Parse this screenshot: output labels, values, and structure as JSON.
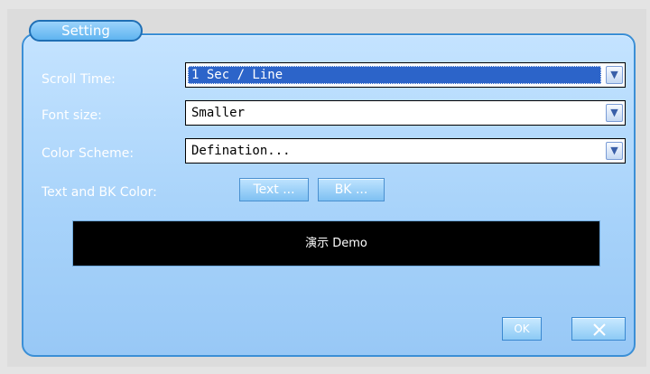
{
  "tab": {
    "label": "Setting"
  },
  "scroll_time": {
    "label": "Scroll Time:",
    "value": "1 Sec / Line"
  },
  "font_size": {
    "label": "Font size:",
    "value": "Smaller"
  },
  "color_scheme": {
    "label": "Color Scheme:",
    "value": "Defination..."
  },
  "text_bk_color": {
    "label": "Text and BK Color:",
    "text_button": "Text ...",
    "bk_button": "BK ..."
  },
  "demo": {
    "text": "演示 Demo",
    "background": "#000000",
    "foreground": "#ffffff"
  },
  "buttons": {
    "ok": "OK",
    "close_icon": "close-icon"
  },
  "colors": {
    "panel": "#aed7fb",
    "panel_border": "#3b8fd6",
    "selection": "#2c64c9"
  }
}
